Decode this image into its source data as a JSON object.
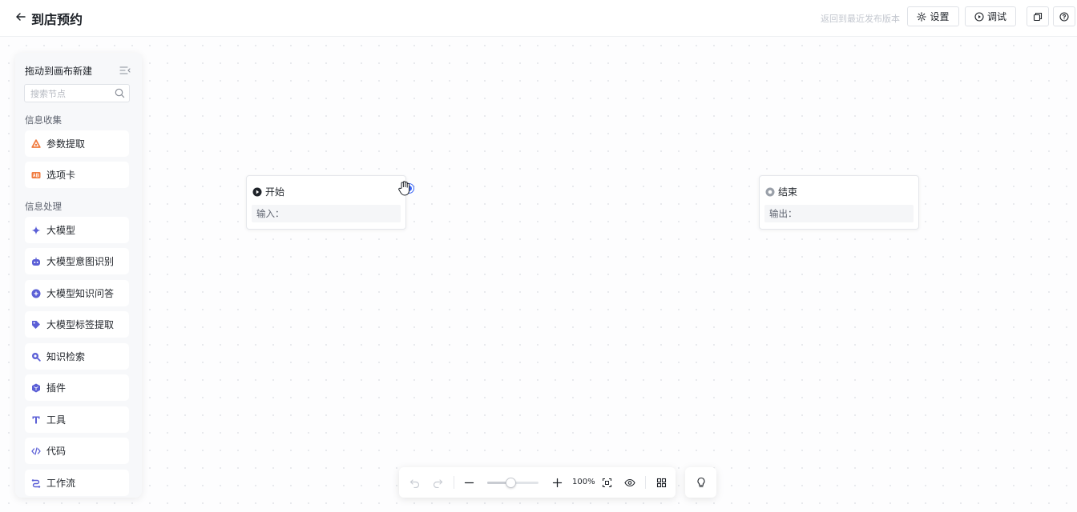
{
  "header": {
    "back_icon": "arrow-left-icon",
    "title": "到店预约",
    "back_to_version": "返回到最近发布版本",
    "settings_label": "设置",
    "debug_label": "调试"
  },
  "sidebar": {
    "title": "拖动到画布新建",
    "search_placeholder": "搜索节点",
    "sections": [
      {
        "label": "信息收集",
        "items": [
          {
            "label": "参数提取",
            "icon": "recycle-triangle-icon",
            "color": "#f07b3f"
          },
          {
            "label": "选项卡",
            "icon": "ab-card-icon",
            "color": "#f07b3f"
          }
        ]
      },
      {
        "label": "信息处理",
        "items": [
          {
            "label": "大模型",
            "icon": "sparkle-icon",
            "color": "#5b5fd6"
          },
          {
            "label": "大模型意图识别",
            "icon": "robot-icon",
            "color": "#5b5fd6"
          },
          {
            "label": "大模型知识问答",
            "icon": "plus-circle-icon",
            "color": "#5b5fd6"
          },
          {
            "label": "大模型标签提取",
            "icon": "tag-icon",
            "color": "#5b5fd6"
          },
          {
            "label": "知识检索",
            "icon": "search-knowledge-icon",
            "color": "#5b5fd6"
          },
          {
            "label": "插件",
            "icon": "cube-icon",
            "color": "#5b5fd6"
          },
          {
            "label": "工具",
            "icon": "tool-icon",
            "color": "#5b5fd6"
          },
          {
            "label": "代码",
            "icon": "code-icon",
            "color": "#5b5fd6"
          },
          {
            "label": "工作流",
            "icon": "workflow-icon",
            "color": "#5b5fd6"
          }
        ]
      }
    ]
  },
  "nodes": {
    "start": {
      "title": "开始",
      "field_label": "输入："
    },
    "end": {
      "title": "结束",
      "field_label": "输出："
    }
  },
  "toolbar": {
    "zoom_label": "100%",
    "zoom_level": 0.45
  },
  "colors": {
    "accent": "#3b66f5",
    "node_icon_purple": "#5b5fd6",
    "node_icon_orange": "#f07b3f"
  }
}
